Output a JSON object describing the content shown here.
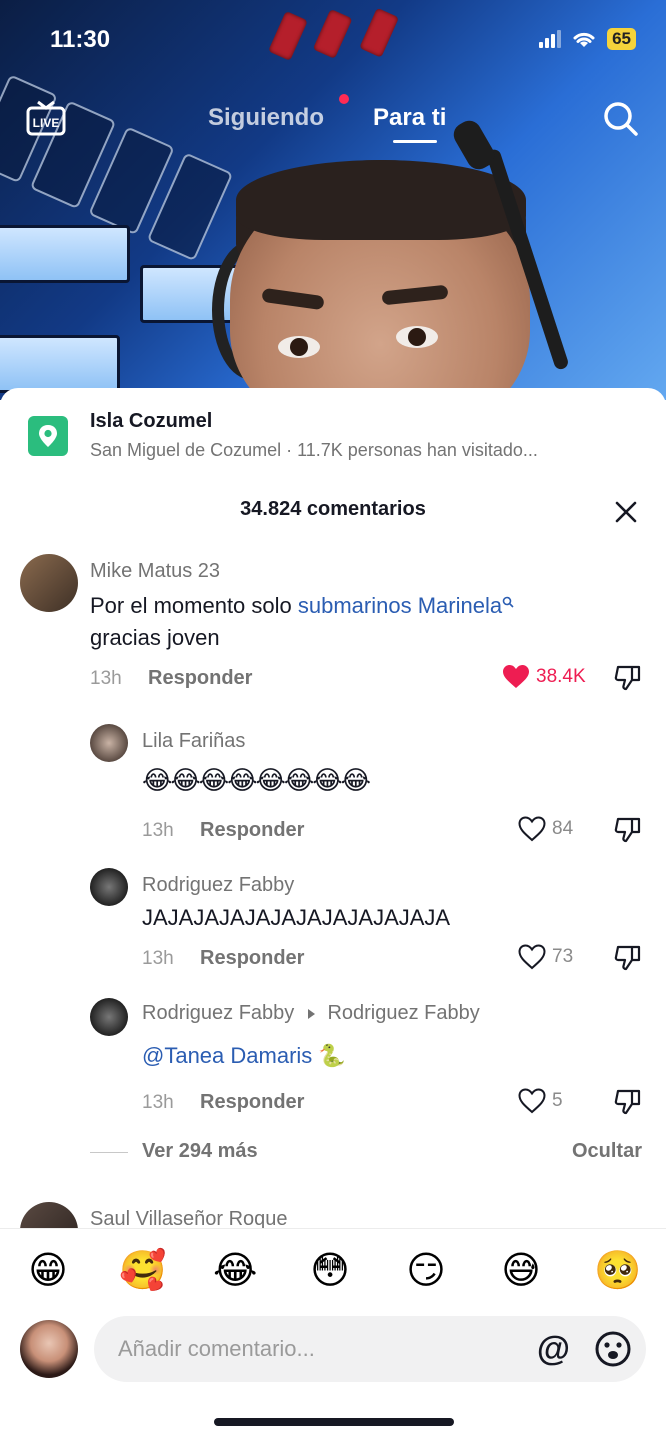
{
  "status": {
    "time": "11:30",
    "battery": "65"
  },
  "nav": {
    "live_label": "LIVE",
    "following": "Siguiendo",
    "for_you": "Para ti"
  },
  "location": {
    "title": "Isla Cozumel",
    "subtitle": "San Miguel de Cozumel · 11.7K personas han visitado..."
  },
  "comments_header": {
    "count": "34.824 comentarios"
  },
  "comments": [
    {
      "author": "Mike Matus 23",
      "text_prefix": "Por el momento solo ",
      "link": "submarinos Marinela",
      "text_suffix": "gracias joven",
      "time": "13h",
      "reply": "Responder",
      "likes": "38.4K",
      "liked": true
    },
    {
      "author": "Lila Fariñas",
      "text": "😂😂😂😂😂😂😂😂",
      "time": "13h",
      "reply": "Responder",
      "likes": "84"
    },
    {
      "author": "Rodriguez Fabby",
      "text": "JAJAJAJAJAJAJAJAJAJAJAJA",
      "time": "13h",
      "reply": "Responder",
      "likes": "73"
    },
    {
      "author": "Rodriguez Fabby",
      "reply_to": "Rodriguez Fabby",
      "mention": "@Tanea Damaris",
      "emoji": "🐍",
      "time": "13h",
      "reply": "Responder",
      "likes": "5"
    }
  ],
  "more": {
    "view_more": "Ver 294 más",
    "hide": "Ocultar"
  },
  "next_comment": {
    "author": "Saul Villaseñor Roque"
  },
  "quick_emojis": [
    "😁",
    "🥰",
    "😂",
    "😳",
    "😏",
    "😅",
    "🥺"
  ],
  "input": {
    "placeholder": "Añadir comentario...",
    "at_symbol": "@"
  },
  "colors": {
    "like": "#ee1d52",
    "link": "#2b5db2",
    "location_pin": "#2bbd7e",
    "battery": "#f5d33b"
  }
}
